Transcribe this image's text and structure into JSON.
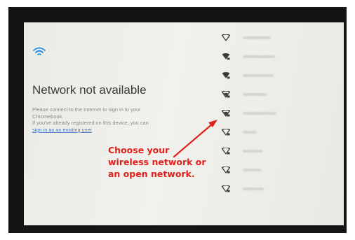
{
  "screen": {
    "title": "Network not available",
    "description": {
      "line1": "Please connect to the Internet to sign in to your",
      "line2": "Chromebook.",
      "line3": "If you've already registered on this device, you can",
      "link": "sign in as an existing user",
      "link_suffix": "."
    },
    "networks": [
      {
        "icon": "wifi-icon",
        "name_width": 40
      },
      {
        "icon": "wifi-icon",
        "name_width": 46
      },
      {
        "icon": "wifi-icon",
        "name_width": 44
      },
      {
        "icon": "wifi-icon",
        "name_width": 34
      },
      {
        "icon": "wifi-icon",
        "name_width": 48
      },
      {
        "icon": "wifi-icon",
        "name_width": 20
      },
      {
        "icon": "wifi-icon",
        "name_width": 28
      },
      {
        "icon": "wifi-icon",
        "name_width": 26
      },
      {
        "icon": "wifi-icon",
        "name_width": 30
      }
    ]
  },
  "annotation": {
    "line1": "Choose your",
    "line2": "wireless network or",
    "line3": "an open network.",
    "color": "#e0201c"
  },
  "colors": {
    "link": "#4a78c4",
    "wifi_accent": "#1e88e5",
    "frame": "#141414"
  }
}
